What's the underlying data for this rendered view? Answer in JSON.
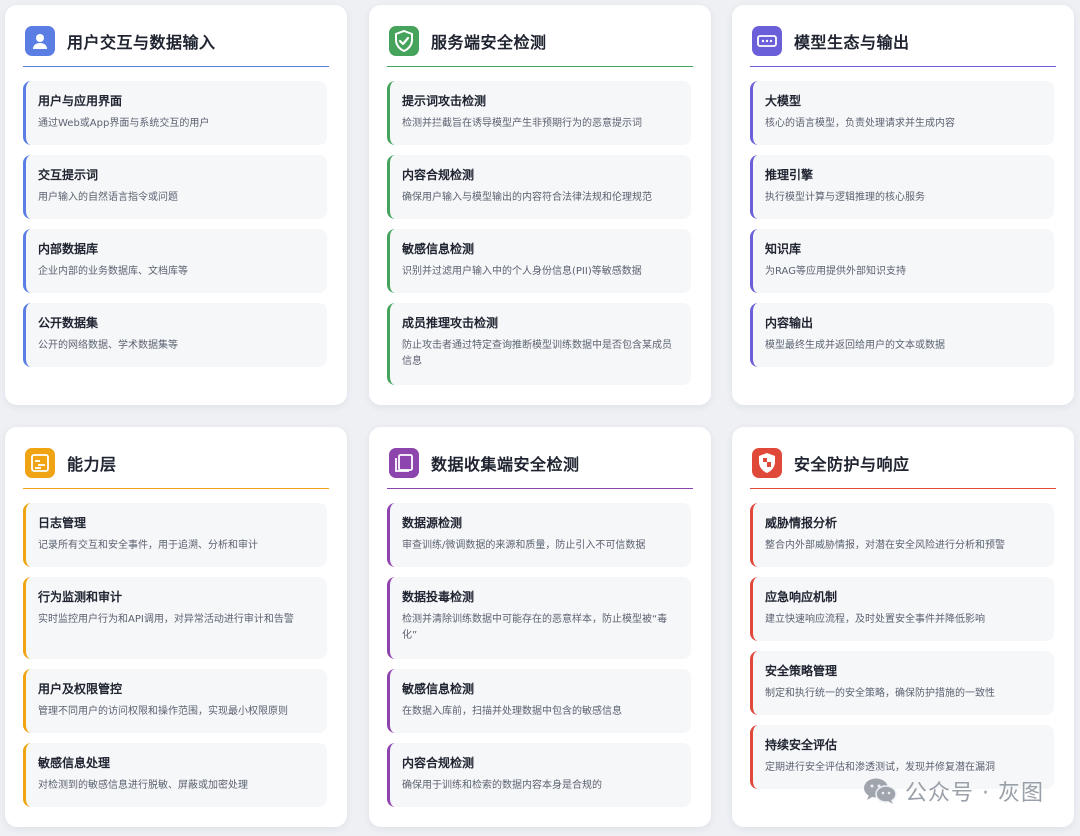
{
  "colors": {
    "blue": "#5b7ee5",
    "green": "#45a35c",
    "indigo": "#6b5fd9",
    "orange": "#f0a313",
    "purple": "#8e44ad",
    "red": "#e0483a"
  },
  "cards": [
    {
      "title": "用户交互与数据输入",
      "icon": "user-icon",
      "items": [
        {
          "title": "用户与应用界面",
          "desc": "通过Web或App界面与系统交互的用户"
        },
        {
          "title": "交互提示词",
          "desc": "用户输入的自然语言指令或问题"
        },
        {
          "title": "内部数据库",
          "desc": "企业内部的业务数据库、文档库等"
        },
        {
          "title": "公开数据集",
          "desc": "公开的网络数据、学术数据集等"
        }
      ]
    },
    {
      "title": "服务端安全检测",
      "icon": "shield-check-icon",
      "items": [
        {
          "title": "提示词攻击检测",
          "desc": "检测并拦截旨在诱导模型产生非预期行为的恶意提示词"
        },
        {
          "title": "内容合规检测",
          "desc": "确保用户输入与模型输出的内容符合法律法规和伦理规范"
        },
        {
          "title": "敏感信息检测",
          "desc": "识别并过滤用户输入中的个人身份信息(PII)等敏感数据"
        },
        {
          "title": "成员推理攻击检测",
          "desc": "防止攻击者通过特定查询推断模型训练数据中是否包含某成员信息"
        }
      ]
    },
    {
      "title": "模型生态与输出",
      "icon": "server-icon",
      "items": [
        {
          "title": "大模型",
          "desc": "核心的语言模型，负责处理请求并生成内容"
        },
        {
          "title": "推理引擎",
          "desc": "执行模型计算与逻辑推理的核心服务"
        },
        {
          "title": "知识库",
          "desc": "为RAG等应用提供外部知识支持"
        },
        {
          "title": "内容输出",
          "desc": "模型最终生成并返回给用户的文本或数据"
        }
      ]
    },
    {
      "title": "能力层",
      "icon": "log-icon",
      "items": [
        {
          "title": "日志管理",
          "desc": "记录所有交互和安全事件，用于追溯、分析和审计"
        },
        {
          "title": "行为监测和审计",
          "desc": "实时监控用户行为和API调用，对异常活动进行审计和告警"
        },
        {
          "title": "用户及权限管控",
          "desc": "管理不同用户的访问权限和操作范围，实现最小权限原则"
        },
        {
          "title": "敏感信息处理",
          "desc": "对检测到的敏感信息进行脱敏、屏蔽或加密处理"
        }
      ]
    },
    {
      "title": "数据收集端安全检测",
      "icon": "data-collection-icon",
      "items": [
        {
          "title": "数据源检测",
          "desc": "审查训练/微调数据的来源和质量，防止引入不可信数据"
        },
        {
          "title": "数据投毒检测",
          "desc": "检测并清除训练数据中可能存在的恶意样本，防止模型被“毒化”"
        },
        {
          "title": "敏感信息检测",
          "desc": "在数据入库前，扫描并处理数据中包含的敏感信息"
        },
        {
          "title": "内容合规检测",
          "desc": "确保用于训练和检索的数据内容本身是合规的"
        }
      ]
    },
    {
      "title": "安全防护与响应",
      "icon": "shield-alert-icon",
      "items": [
        {
          "title": "威胁情报分析",
          "desc": "整合内外部威胁情报，对潜在安全风险进行分析和预警"
        },
        {
          "title": "应急响应机制",
          "desc": "建立快速响应流程，及时处置安全事件并降低影响"
        },
        {
          "title": "安全策略管理",
          "desc": "制定和执行统一的安全策略，确保防护措施的一致性"
        },
        {
          "title": "持续安全评估",
          "desc": "定期进行安全评估和渗透测试，发现并修复潜在漏洞"
        }
      ]
    }
  ],
  "watermark": {
    "text": "公众号 · 灰图",
    "icon": "wechat-icon"
  }
}
